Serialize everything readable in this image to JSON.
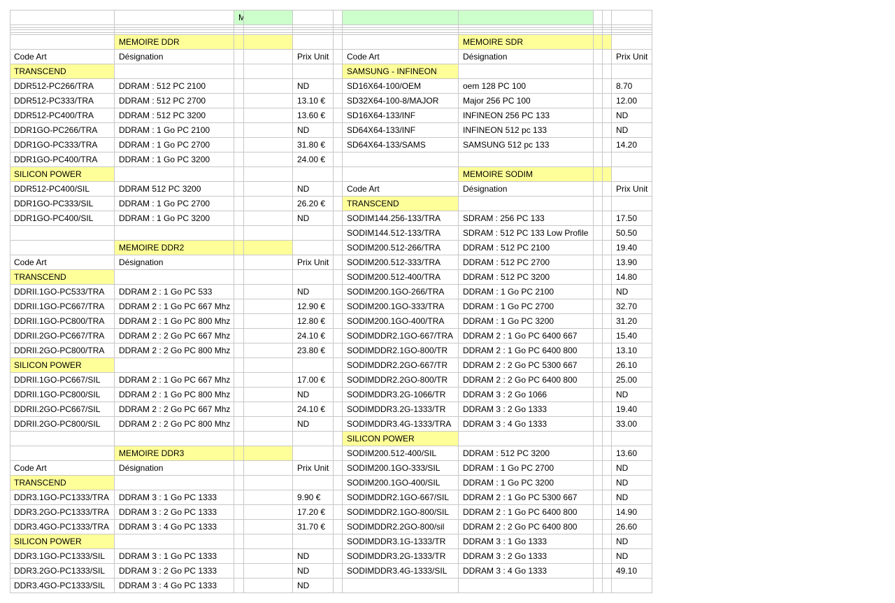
{
  "colors": {
    "section_header": "#ffff99",
    "title_band": "#ccffcc",
    "grid": "#c8c8c8"
  },
  "title": "MEMOIRE",
  "columns": {
    "code": "Code Art",
    "designation": "Désignation",
    "price": "Prix Unit"
  },
  "left": [
    {
      "type": "section",
      "title": "MEMOIRE DDR"
    },
    {
      "type": "colhead"
    },
    {
      "type": "brand",
      "name": "TRANSCEND"
    },
    {
      "type": "item",
      "code": "DDR512-PC266/TRA",
      "designation": "DDRAM : 512 PC 2100",
      "price": "ND"
    },
    {
      "type": "item",
      "code": "DDR512-PC333/TRA",
      "designation": "DDRAM : 512 PC 2700",
      "price": "13.10 €"
    },
    {
      "type": "item",
      "code": "DDR512-PC400/TRA",
      "designation": "DDRAM : 512 PC 3200",
      "price": "13.60 €"
    },
    {
      "type": "item",
      "code": "DDR1GO-PC266/TRA",
      "designation": "DDRAM : 1 Go PC 2100",
      "price": "ND"
    },
    {
      "type": "item",
      "code": "DDR1GO-PC333/TRA",
      "designation": "DDRAM : 1 Go PC 2700",
      "price": "31.80 €"
    },
    {
      "type": "item",
      "code": "DDR1GO-PC400/TRA",
      "designation": "DDRAM : 1 Go PC 3200",
      "price": "24.00 €"
    },
    {
      "type": "brand",
      "name": "SILICON POWER"
    },
    {
      "type": "item",
      "code": "DDR512-PC400/SIL",
      "designation": "DDRAM 512 PC 3200",
      "price": "ND"
    },
    {
      "type": "item",
      "code": "DDR1GO-PC333/SIL",
      "designation": "DDRAM : 1 Go PC 2700",
      "price": "26.20 €"
    },
    {
      "type": "item",
      "code": "DDR1GO-PC400/SIL",
      "designation": "DDRAM : 1 Go PC 3200",
      "price": "ND"
    },
    {
      "type": "blank"
    },
    {
      "type": "section",
      "title": "MEMOIRE DDR2"
    },
    {
      "type": "colhead"
    },
    {
      "type": "brand",
      "name": "TRANSCEND"
    },
    {
      "type": "item",
      "code": "DDRII.1GO-PC533/TRA",
      "designation": "DDRAM 2 : 1 Go PC 533",
      "price": "ND"
    },
    {
      "type": "item",
      "code": "DDRII.1GO-PC667/TRA",
      "designation": "DDRAM 2 : 1 Go PC 667 Mhz",
      "price": "12.90 €"
    },
    {
      "type": "item",
      "code": "DDRII.1GO-PC800/TRA",
      "designation": "DDRAM 2 : 1 Go PC 800 Mhz",
      "price": "12.80 €"
    },
    {
      "type": "item",
      "code": "DDRII.2GO-PC667/TRA",
      "designation": "DDRAM 2 : 2 Go PC 667 Mhz",
      "price": "24.10 €"
    },
    {
      "type": "item",
      "code": "DDRII.2GO-PC800/TRA",
      "designation": "DDRAM 2 : 2 Go PC 800 Mhz",
      "price": "23.80 €"
    },
    {
      "type": "brand",
      "name": "SILICON POWER"
    },
    {
      "type": "item",
      "code": "DDRII.1GO-PC667/SIL",
      "designation": "DDRAM 2 : 1 Go PC 667 Mhz",
      "price": "17.00 €"
    },
    {
      "type": "item",
      "code": "DDRII.1GO-PC800/SIL",
      "designation": "DDRAM 2 : 1 Go PC 800 Mhz",
      "price": "ND"
    },
    {
      "type": "item",
      "code": "DDRII.2GO-PC667/SIL",
      "designation": "DDRAM 2 : 2 Go PC 667 Mhz",
      "price": "24.10 €"
    },
    {
      "type": "item",
      "code": "DDRII.2GO-PC800/SIL",
      "designation": "DDRAM 2 : 2 Go PC 800 Mhz",
      "price": "ND"
    },
    {
      "type": "blank"
    },
    {
      "type": "section",
      "title": "MEMOIRE DDR3"
    },
    {
      "type": "colhead"
    },
    {
      "type": "brand",
      "name": "TRANSCEND"
    },
    {
      "type": "item",
      "code": "DDR3.1GO-PC1333/TRA",
      "designation": "DDRAM 3 : 1 Go PC 1333",
      "price": "9.90 €"
    },
    {
      "type": "item",
      "code": "DDR3.2GO-PC1333/TRA",
      "designation": "DDRAM 3 : 2 Go PC 1333",
      "price": "17.20 €"
    },
    {
      "type": "item",
      "code": "DDR3.4GO-PC1333/TRA",
      "designation": "DDRAM 3 : 4 Go PC 1333",
      "price": "31.70 €"
    },
    {
      "type": "brand",
      "name": "SILICON POWER"
    },
    {
      "type": "item",
      "code": "DDR3.1GO-PC1333/SIL",
      "designation": "DDRAM 3 : 1 Go PC 1333",
      "price": "ND"
    },
    {
      "type": "item",
      "code": "DDR3.2GO-PC1333/SIL",
      "designation": "DDRAM 3 : 2 Go PC 1333",
      "price": "ND"
    },
    {
      "type": "item",
      "code": "DDR3.4GO-PC1333/SIL",
      "designation": "DDRAM 3 : 4 Go PC 1333",
      "price": "ND"
    }
  ],
  "right": [
    {
      "type": "section",
      "title": "MEMOIRE SDR"
    },
    {
      "type": "colhead"
    },
    {
      "type": "brand",
      "name": "SAMSUNG - INFINEON"
    },
    {
      "type": "item",
      "code": "SD16X64-100/OEM",
      "designation": "oem 128 PC 100",
      "price": "8.70"
    },
    {
      "type": "item",
      "code": "SD32X64-100-8/MAJOR",
      "designation": "Major 256 PC 100",
      "price": "12.00"
    },
    {
      "type": "item",
      "code": "SD16X64-133/INF",
      "designation": "INFINEON 256 PC 133",
      "price": "ND"
    },
    {
      "type": "item",
      "code": "SD64X64-133/INF",
      "designation": "INFINEON 512 pc 133",
      "price": "ND"
    },
    {
      "type": "item",
      "code": "SD64X64-133/SAMS",
      "designation": "SAMSUNG 512 pc 133",
      "price": "14.20"
    },
    {
      "type": "blank"
    },
    {
      "type": "section",
      "title": "MEMOIRE SODIM"
    },
    {
      "type": "colhead"
    },
    {
      "type": "brand",
      "name": "TRANSCEND"
    },
    {
      "type": "item",
      "code": "SODIM144.256-133/TRA",
      "designation": "SDRAM : 256 PC 133",
      "price": "17.50"
    },
    {
      "type": "item",
      "code": "SODIM144.512-133/TRA",
      "designation": "SDRAM : 512 PC 133 Low Profile",
      "price": "50.50"
    },
    {
      "type": "item",
      "code": "SODIM200.512-266/TRA",
      "designation": "DDRAM : 512 PC 2100",
      "price": "19.40"
    },
    {
      "type": "item",
      "code": "SODIM200.512-333/TRA",
      "designation": "DDRAM : 512 PC 2700",
      "price": "13.90"
    },
    {
      "type": "item",
      "code": "SODIM200.512-400/TRA",
      "designation": "DDRAM : 512 PC 3200",
      "price": "14.80"
    },
    {
      "type": "item",
      "code": "SODIM200.1GO-266/TRA",
      "designation": "DDRAM : 1 Go PC 2100",
      "price": "ND"
    },
    {
      "type": "item",
      "code": "SODIM200.1GO-333/TRA",
      "designation": "DDRAM : 1 Go PC 2700",
      "price": "32.70"
    },
    {
      "type": "item",
      "code": "SODIM200.1GO-400/TRA",
      "designation": "DDRAM : 1 Go PC 3200",
      "price": "31.20"
    },
    {
      "type": "item",
      "code": "SODIMDDR2.1GO-667/TRA",
      "designation": "DDRAM 2 : 1 Go PC 6400 667",
      "price": "15.40"
    },
    {
      "type": "item",
      "code": "SODIMDDR2.1GO-800/TR",
      "designation": "DDRAM 2 : 1 Go PC 6400 800",
      "price": "13.10"
    },
    {
      "type": "item",
      "code": "SODIMDDR2.2GO-667/TR",
      "designation": "DDRAM 2 : 2 Go PC 5300 667",
      "price": "26.10"
    },
    {
      "type": "item",
      "code": "SODIMDDR2.2GO-800/TR",
      "designation": "DDRAM 2 : 2 Go PC 6400 800",
      "price": "25.00"
    },
    {
      "type": "item",
      "code": "SODIMDDR3.2G-1066/TR",
      "designation": "DDRAM 3 : 2 Go 1066",
      "price": "ND"
    },
    {
      "type": "item",
      "code": "SODIMDDR3.2G-1333/TR",
      "designation": "DDRAM 3 : 2 Go 1333",
      "price": "19.40"
    },
    {
      "type": "item",
      "code": "SODIMDDR3.4G-1333/TRA",
      "designation": "DDRAM 3 : 4 Go 1333",
      "price": "33.00"
    },
    {
      "type": "brand",
      "name": "SILICON POWER"
    },
    {
      "type": "item",
      "code": "SODIM200.512-400/SIL",
      "designation": "DDRAM : 512 PC 3200",
      "price": "13.60"
    },
    {
      "type": "item",
      "code": "SODIM200.1GO-333/SIL",
      "designation": "DDRAM : 1 Go PC 2700",
      "price": "ND"
    },
    {
      "type": "item",
      "code": "SODIM200.1GO-400/SIL",
      "designation": "DDRAM : 1 Go PC 3200",
      "price": "ND"
    },
    {
      "type": "item",
      "code": "SODIMDDR2.1GO-667/SIL",
      "designation": "DDRAM 2 : 1 Go PC 5300 667",
      "price": "ND"
    },
    {
      "type": "item",
      "code": "SODIMDDR2.1GO-800/SIL",
      "designation": "DDRAM 2 : 1 Go PC 6400 800",
      "price": "14.90"
    },
    {
      "type": "item",
      "code": "SODIMDDR2.2GO-800/sil",
      "designation": "DDRAM 2 : 2 Go PC 6400 800",
      "price": "26.60"
    },
    {
      "type": "item",
      "code": "SODIMDDR3.1G-1333/TR",
      "designation": "DDRAM 3 : 1 Go 1333",
      "price": "ND"
    },
    {
      "type": "item",
      "code": "SODIMDDR3.2G-1333/TR",
      "designation": "DDRAM 3 : 2 Go 1333",
      "price": "ND"
    },
    {
      "type": "item",
      "code": "SODIMDDR3.4G-1333/SIL",
      "designation": "DDRAM 3 : 4 Go 1333",
      "price": "49.10"
    },
    {
      "type": "blank"
    }
  ]
}
